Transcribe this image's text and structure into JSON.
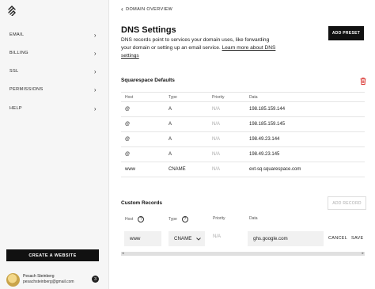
{
  "sidebar": {
    "logo": "squarespace-logo",
    "items": [
      {
        "label": "EMAIL"
      },
      {
        "label": "BILLING"
      },
      {
        "label": "SSL"
      },
      {
        "label": "PERMISSIONS"
      },
      {
        "label": "HELP"
      }
    ],
    "create_button": "CREATE A WEBSITE",
    "user": {
      "name": "Pesach Steinberg",
      "email": "pesachsteinberg@gmail.com",
      "badge": "3"
    }
  },
  "main": {
    "breadcrumb": "DOMAIN OVERVIEW",
    "title": "DNS Settings",
    "add_preset": "ADD PRESET",
    "description": "DNS records point to services your domain uses, like forwarding your domain or setting up an email service.",
    "learn_more": "Learn more about DNS settings",
    "defaults_title": "Squarespace Defaults",
    "columns": {
      "host": "Host",
      "type": "Type",
      "priority": "Priority",
      "data": "Data"
    },
    "default_records": [
      {
        "host": "@",
        "type": "A",
        "priority": "N/A",
        "data": "198.185.159.144"
      },
      {
        "host": "@",
        "type": "A",
        "priority": "N/A",
        "data": "198.185.159.145"
      },
      {
        "host": "@",
        "type": "A",
        "priority": "N/A",
        "data": "198.49.23.144"
      },
      {
        "host": "@",
        "type": "A",
        "priority": "N/A",
        "data": "198.49.23.145"
      },
      {
        "host": "www",
        "type": "CNAME",
        "priority": "N/A",
        "data": "ext-sq.squarespace.com"
      }
    ],
    "custom_title": "Custom Records",
    "add_record": "ADD RECORD",
    "help_glyph": "?",
    "custom_row": {
      "host": "www",
      "type": "CNAME",
      "priority": "N/A",
      "data": "ghs.google.com",
      "cancel": "CANCEL",
      "save": "SAVE"
    }
  },
  "colors": {
    "accent": "#111111",
    "delete": "#d9302c",
    "sidebar_bg": "#f6f6f6"
  }
}
